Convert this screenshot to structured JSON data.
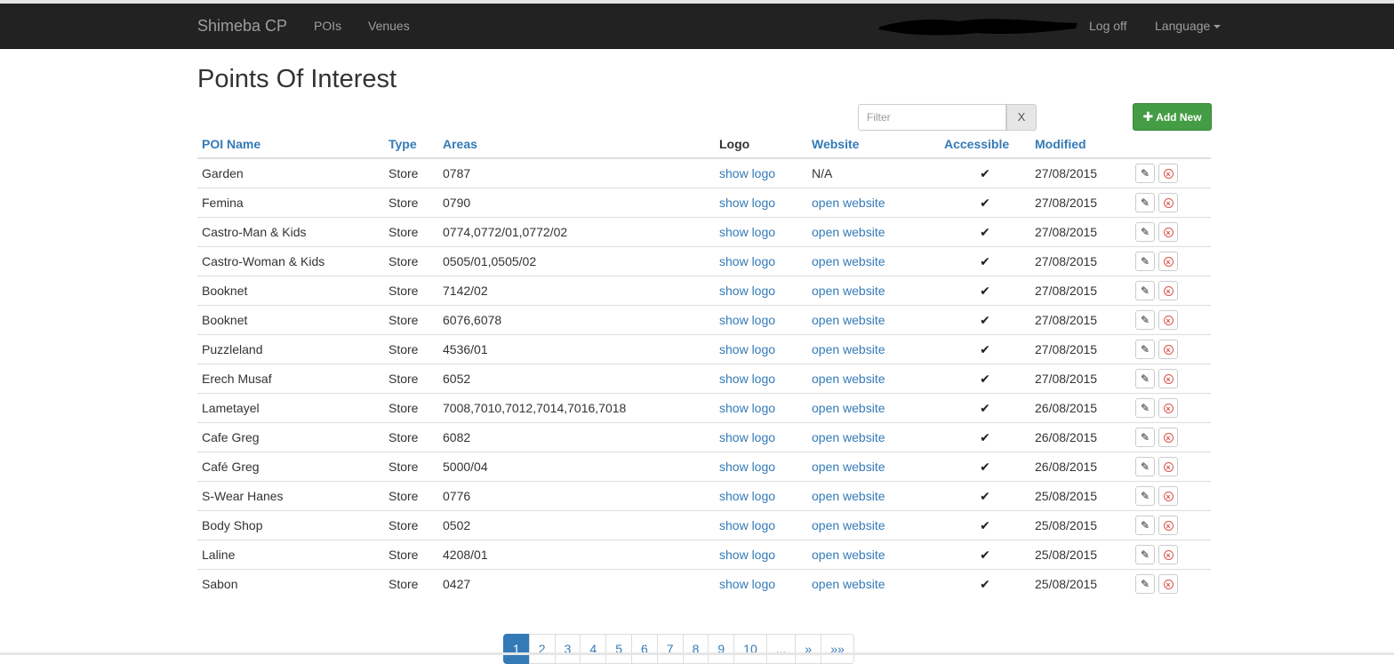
{
  "navbar": {
    "brand": "Shimeba CP",
    "links": [
      "POIs",
      "Venues"
    ],
    "log_off": "Log off",
    "language": "Language"
  },
  "page": {
    "title": "Points Of Interest",
    "filter_placeholder": "Filter",
    "filter_clear": "X",
    "add_new": "Add New"
  },
  "table": {
    "headers": [
      "POI Name",
      "Type",
      "Areas",
      "Logo",
      "Website",
      "Accessible",
      "Modified"
    ],
    "rows": [
      {
        "name": "Garden",
        "type": "Store",
        "areas": "0787",
        "logo": "show logo",
        "website": "N/A",
        "accessible": "✔",
        "modified": "27/08/2015"
      },
      {
        "name": "Femina",
        "type": "Store",
        "areas": "0790",
        "logo": "show logo",
        "website": "open website",
        "accessible": "✔",
        "modified": "27/08/2015"
      },
      {
        "name": "Castro-Man & Kids",
        "type": "Store",
        "areas": "0774,0772/01,0772/02",
        "logo": "show logo",
        "website": "open website",
        "accessible": "✔",
        "modified": "27/08/2015"
      },
      {
        "name": "Castro-Woman & Kids",
        "type": "Store",
        "areas": "0505/01,0505/02",
        "logo": "show logo",
        "website": "open website",
        "accessible": "✔",
        "modified": "27/08/2015"
      },
      {
        "name": "Booknet",
        "type": "Store",
        "areas": "7142/02",
        "logo": "show logo",
        "website": "open website",
        "accessible": "✔",
        "modified": "27/08/2015"
      },
      {
        "name": "Booknet",
        "type": "Store",
        "areas": "6076,6078",
        "logo": "show logo",
        "website": "open website",
        "accessible": "✔",
        "modified": "27/08/2015"
      },
      {
        "name": "Puzzleland",
        "type": "Store",
        "areas": "4536/01",
        "logo": "show logo",
        "website": "open website",
        "accessible": "✔",
        "modified": "27/08/2015"
      },
      {
        "name": "Erech Musaf",
        "type": "Store",
        "areas": "6052",
        "logo": "show logo",
        "website": "open website",
        "accessible": "✔",
        "modified": "27/08/2015"
      },
      {
        "name": "Lametayel",
        "type": "Store",
        "areas": "7008,7010,7012,7014,7016,7018",
        "logo": "show logo",
        "website": "open website",
        "accessible": "✔",
        "modified": "26/08/2015"
      },
      {
        "name": "Cafe Greg",
        "type": "Store",
        "areas": "6082",
        "logo": "show logo",
        "website": "open website",
        "accessible": "✔",
        "modified": "26/08/2015"
      },
      {
        "name": "Café Greg",
        "type": "Store",
        "areas": "5000/04",
        "logo": "show logo",
        "website": "open website",
        "accessible": "✔",
        "modified": "26/08/2015"
      },
      {
        "name": "S-Wear Hanes",
        "type": "Store",
        "areas": "0776",
        "logo": "show logo",
        "website": "open website",
        "accessible": "✔",
        "modified": "25/08/2015"
      },
      {
        "name": "Body Shop",
        "type": "Store",
        "areas": "0502",
        "logo": "show logo",
        "website": "open website",
        "accessible": "✔",
        "modified": "25/08/2015"
      },
      {
        "name": "Laline",
        "type": "Store",
        "areas": "4208/01",
        "logo": "show logo",
        "website": "open website",
        "accessible": "✔",
        "modified": "25/08/2015"
      },
      {
        "name": "Sabon",
        "type": "Store",
        "areas": "0427",
        "logo": "show logo",
        "website": "open website",
        "accessible": "✔",
        "modified": "25/08/2015"
      }
    ]
  },
  "pagination": {
    "pages": [
      "1",
      "2",
      "3",
      "4",
      "5",
      "6",
      "7",
      "8",
      "9",
      "10",
      "...",
      "»",
      "»»"
    ],
    "active": "1"
  },
  "colors": {
    "navbar_bg": "#222222",
    "link": "#337ab7",
    "add_button": "#449d44",
    "remove": "#d9534f"
  }
}
